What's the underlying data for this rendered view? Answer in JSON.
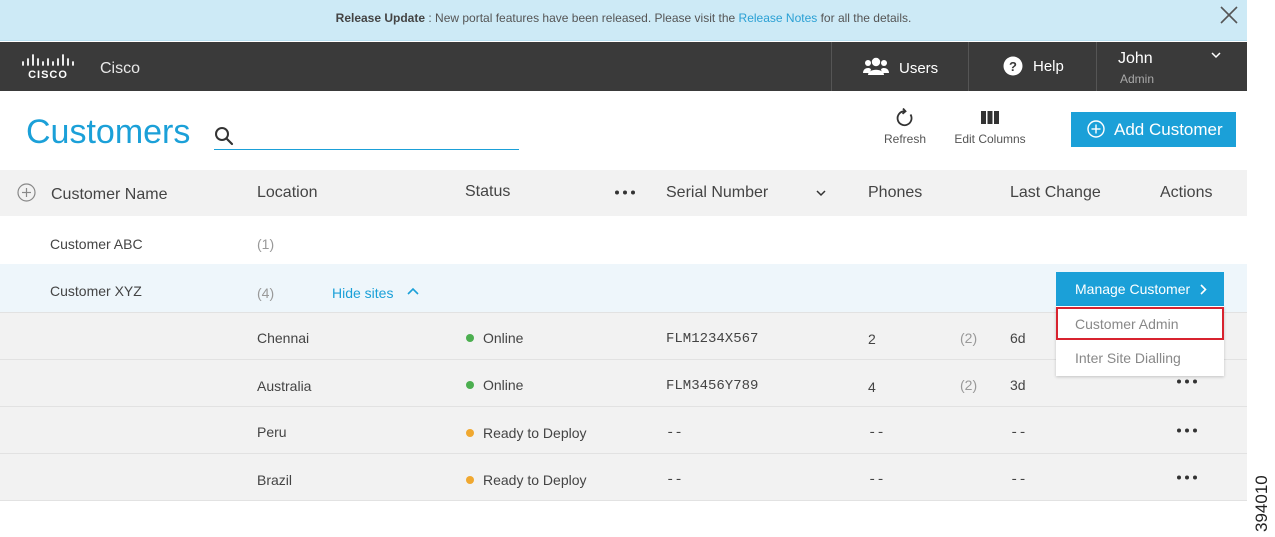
{
  "banner": {
    "bold": "Release Update",
    "text_before": " : New portal features have been released. Please visit the ",
    "link": "Release Notes",
    "text_after": " for all the details.",
    "close_icon": "close-icon"
  },
  "header": {
    "app_name": "Cisco",
    "logo": "cisco-logo",
    "users_label": "Users",
    "help_label": "Help",
    "user_name": "John",
    "user_role": "Admin"
  },
  "page": {
    "title": "Customers",
    "search_placeholder": "",
    "refresh_label": "Refresh",
    "edit_columns_label": "Edit Columns",
    "add_customer_label": "Add Customer"
  },
  "table": {
    "headers": {
      "customer_name": "Customer Name",
      "location": "Location",
      "status": "Status",
      "serial_number": "Serial Number",
      "phones": "Phones",
      "last_change": "Last Change",
      "actions": "Actions"
    },
    "customers": [
      {
        "name": "Customer ABC",
        "count": "(1)"
      },
      {
        "name": "Customer XYZ",
        "count": "(4)",
        "toggle_label": "Hide sites"
      }
    ],
    "sites": [
      {
        "location": "Chennai",
        "status": "Online",
        "status_color": "#4caf50",
        "serial": "FLM1234X567",
        "phones": "2",
        "count": "(2)",
        "last_change": "6d"
      },
      {
        "location": "Australia",
        "status": "Online",
        "status_color": "#4caf50",
        "serial": "FLM3456Y789",
        "phones": "4",
        "count": "(2)",
        "last_change": "3d"
      },
      {
        "location": "Peru",
        "status": "Ready to Deploy",
        "status_color": "#f0a830",
        "serial": "--",
        "phones": "--",
        "last_change": "--"
      },
      {
        "location": "Brazil",
        "status": "Ready to Deploy",
        "status_color": "#f0a830",
        "serial": "--",
        "phones": "--",
        "last_change": "--"
      }
    ]
  },
  "manage_menu": {
    "button_label": "Manage Customer",
    "items": [
      "Customer Admin",
      "Inter Site Dialling"
    ]
  },
  "figure_id": "394010",
  "colors": {
    "accent": "#1ba0d8",
    "header_bg": "#3a3a3a",
    "banner_bg": "#cdeaf6",
    "highlight": "#d8232f"
  }
}
